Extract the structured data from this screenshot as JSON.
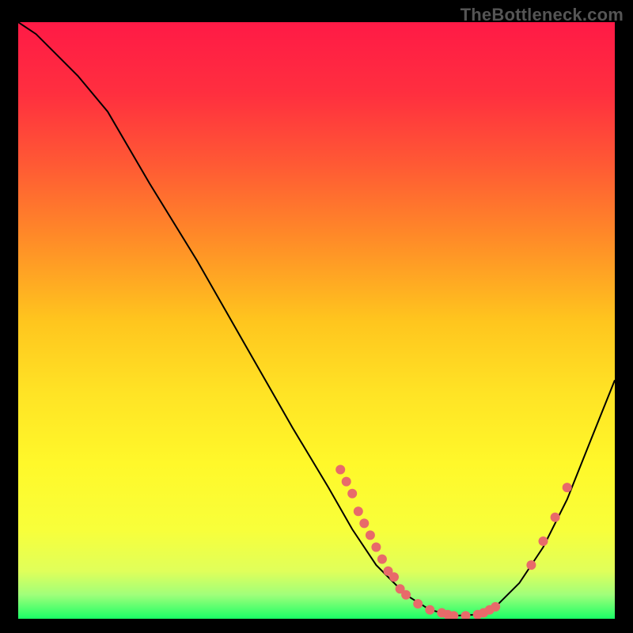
{
  "watermark": "TheBottleneck.com",
  "chart_data": {
    "type": "line",
    "title": "",
    "xlabel": "",
    "ylabel": "",
    "xlim": [
      0,
      100
    ],
    "ylim": [
      0,
      100
    ],
    "gradient_stops": [
      {
        "offset": 0,
        "color": "#ff1a46"
      },
      {
        "offset": 12,
        "color": "#ff2f3f"
      },
      {
        "offset": 24,
        "color": "#ff5a34"
      },
      {
        "offset": 36,
        "color": "#ff8a28"
      },
      {
        "offset": 50,
        "color": "#ffc51e"
      },
      {
        "offset": 62,
        "color": "#ffe325"
      },
      {
        "offset": 74,
        "color": "#fff82a"
      },
      {
        "offset": 85,
        "color": "#f8ff3a"
      },
      {
        "offset": 92,
        "color": "#e0ff5a"
      },
      {
        "offset": 96,
        "color": "#a0ff7a"
      },
      {
        "offset": 100,
        "color": "#1aff66"
      }
    ],
    "curve": [
      {
        "x": 0,
        "y": 100
      },
      {
        "x": 3,
        "y": 98
      },
      {
        "x": 6,
        "y": 95
      },
      {
        "x": 10,
        "y": 91
      },
      {
        "x": 15,
        "y": 85
      },
      {
        "x": 22,
        "y": 73
      },
      {
        "x": 30,
        "y": 60
      },
      {
        "x": 38,
        "y": 46
      },
      {
        "x": 46,
        "y": 32
      },
      {
        "x": 52,
        "y": 22
      },
      {
        "x": 56,
        "y": 15
      },
      {
        "x": 60,
        "y": 9
      },
      {
        "x": 65,
        "y": 4
      },
      {
        "x": 69,
        "y": 1.5
      },
      {
        "x": 73,
        "y": 0.5
      },
      {
        "x": 77,
        "y": 0.7
      },
      {
        "x": 80,
        "y": 2
      },
      {
        "x": 84,
        "y": 6
      },
      {
        "x": 88,
        "y": 12
      },
      {
        "x": 92,
        "y": 20
      },
      {
        "x": 96,
        "y": 30
      },
      {
        "x": 100,
        "y": 40
      }
    ],
    "points": [
      {
        "x": 54,
        "y": 25
      },
      {
        "x": 55,
        "y": 23
      },
      {
        "x": 56,
        "y": 21
      },
      {
        "x": 57,
        "y": 18
      },
      {
        "x": 58,
        "y": 16
      },
      {
        "x": 59,
        "y": 14
      },
      {
        "x": 60,
        "y": 12
      },
      {
        "x": 61,
        "y": 10
      },
      {
        "x": 62,
        "y": 8
      },
      {
        "x": 63,
        "y": 7
      },
      {
        "x": 64,
        "y": 5
      },
      {
        "x": 65,
        "y": 4
      },
      {
        "x": 67,
        "y": 2.5
      },
      {
        "x": 69,
        "y": 1.5
      },
      {
        "x": 71,
        "y": 1
      },
      {
        "x": 72,
        "y": 0.7
      },
      {
        "x": 73,
        "y": 0.5
      },
      {
        "x": 75,
        "y": 0.5
      },
      {
        "x": 77,
        "y": 0.7
      },
      {
        "x": 78,
        "y": 1
      },
      {
        "x": 79,
        "y": 1.5
      },
      {
        "x": 80,
        "y": 2
      },
      {
        "x": 86,
        "y": 9
      },
      {
        "x": 88,
        "y": 13
      },
      {
        "x": 90,
        "y": 17
      },
      {
        "x": 92,
        "y": 22
      }
    ],
    "point_color": "#e86a6a",
    "point_radius": 6,
    "line_color": "#000000"
  }
}
